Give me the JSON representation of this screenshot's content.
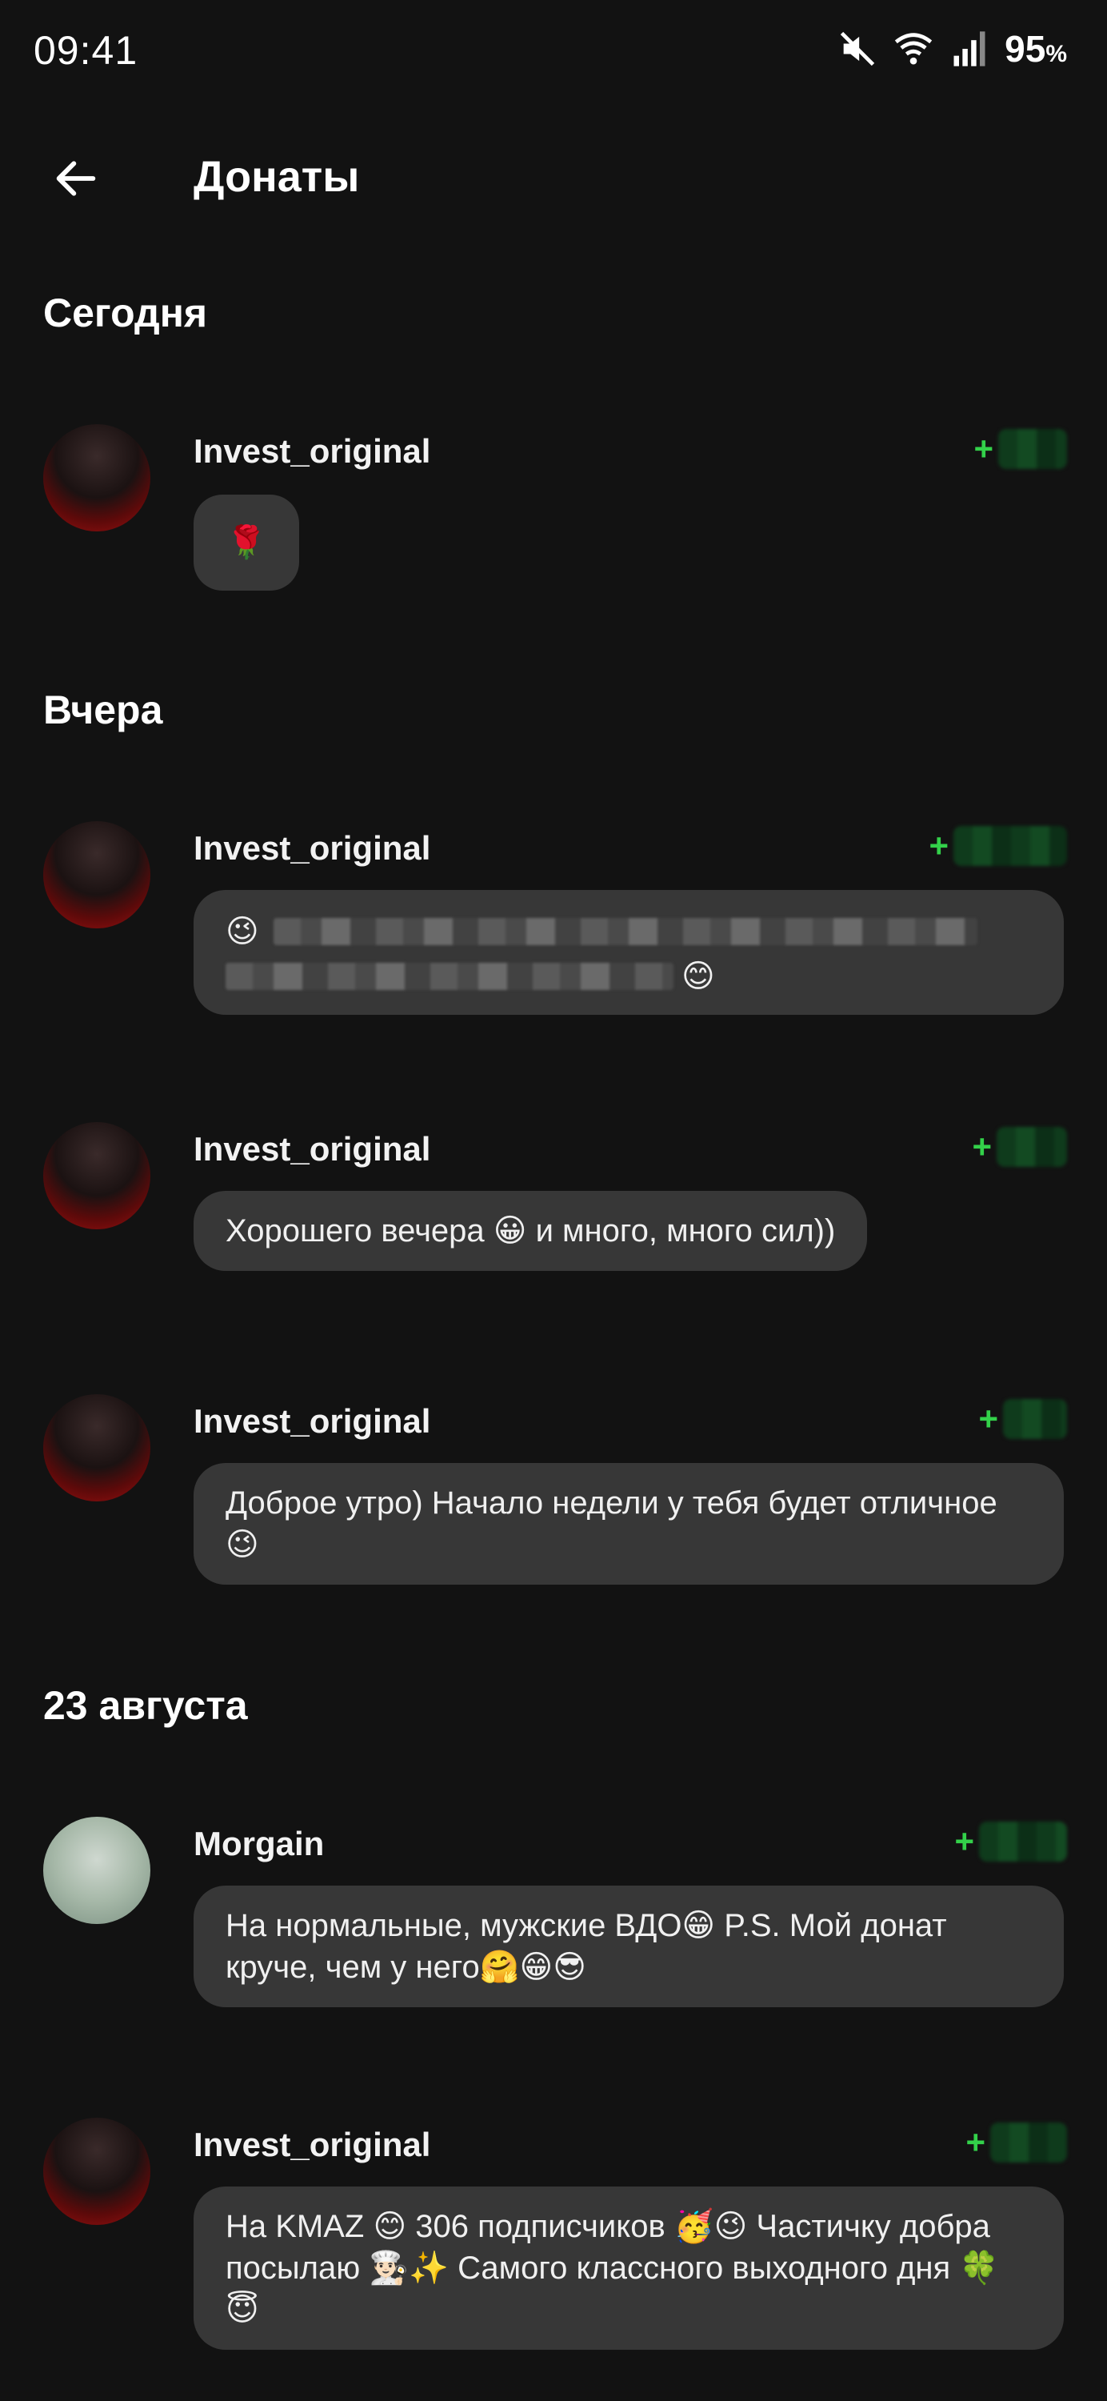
{
  "status_bar": {
    "time": "09:41",
    "battery_percent": "95",
    "battery_symbol": "%",
    "icons": [
      "mute-icon",
      "wifi-icon",
      "signal-icon"
    ]
  },
  "app_bar": {
    "title": "Донаты",
    "back_icon": "arrow-left-icon"
  },
  "sections": [
    {
      "header": "Сегодня",
      "items": [
        {
          "username": "Invest_original",
          "amount_prefix": "+",
          "message": "🌹"
        }
      ]
    },
    {
      "header": "Вчера",
      "items": [
        {
          "username": "Invest_original",
          "amount_prefix": "+",
          "message_prefix": "😉",
          "message_suffix": "😊"
        },
        {
          "username": "Invest_original",
          "amount_prefix": "+",
          "message": "Хорошего вечера 😀 и много, много сил))"
        },
        {
          "username": "Invest_original",
          "amount_prefix": "+",
          "message": "Доброе утро) Начало недели у тебя будет отличное 😉"
        }
      ]
    },
    {
      "header": "23 августа",
      "items": [
        {
          "username": "Morgain",
          "amount_prefix": "+",
          "message": "На нормальные, мужские ВДО😁 P.S. Мой донат круче, чем у него🤗😁😎"
        },
        {
          "username": "Invest_original",
          "amount_prefix": "+",
          "message": "На KMAZ 😊  306 подписчиков 🥳😉  Частичку добра посылаю 👨🏻‍🍳✨  Самого классного выходного дня 🍀😇"
        }
      ]
    }
  ],
  "colors": {
    "background": "#121212",
    "bubble": "#373737",
    "amount_green": "#33d14a"
  }
}
